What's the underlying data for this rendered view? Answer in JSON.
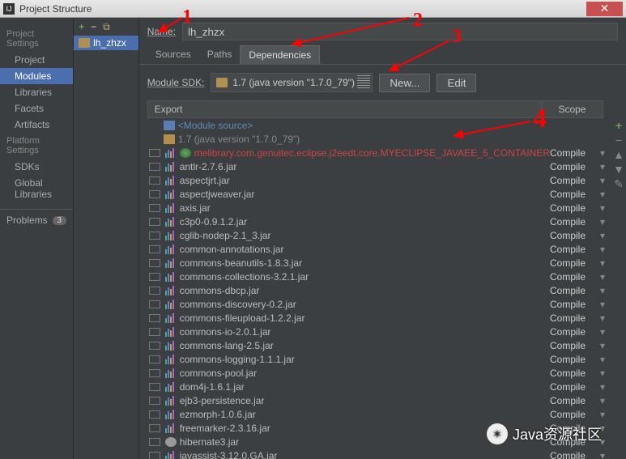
{
  "titlebar": {
    "title": "Project Structure"
  },
  "sidebar": {
    "project_settings_label": "Project Settings",
    "platform_settings_label": "Platform Settings",
    "items": {
      "project": "Project",
      "modules": "Modules",
      "libraries": "Libraries",
      "facets": "Facets",
      "artifacts": "Artifacts",
      "sdks": "SDKs",
      "global_libraries": "Global Libraries"
    },
    "problems_label": "Problems",
    "problems_count": "3"
  },
  "modules": {
    "selected": "lh_zhzx"
  },
  "content": {
    "name_label": "Name:",
    "name_value": "lh_zhzx",
    "tabs": {
      "sources": "Sources",
      "paths": "Paths",
      "dependencies": "Dependencies"
    },
    "sdk_label": "Module SDK:",
    "sdk_value": "1.7 (java version \"1.7.0_79\")",
    "btn_new": "New...",
    "btn_edit": "Edit",
    "header_export": "Export",
    "header_scope": "Scope",
    "dependencies": [
      {
        "kind": "module-src",
        "name": "<Module source>",
        "color": "blue",
        "hasCheck": false,
        "scope": ""
      },
      {
        "kind": "sdk",
        "name": "1.7 (java version \"1.7.0_79\")",
        "color": "gray",
        "hasCheck": false,
        "scope": ""
      },
      {
        "kind": "bars",
        "name": "melibrary.com.genuitec.eclipse.j2eedt.core.MYECLIPSE_JAVAEE_5_CONTAINER",
        "color": "red",
        "hasCheck": true,
        "scope": "Compile"
      },
      {
        "kind": "bars",
        "name": "antlr-2.7.6.jar",
        "color": "",
        "hasCheck": true,
        "scope": "Compile"
      },
      {
        "kind": "bars",
        "name": "aspectjrt.jar",
        "color": "",
        "hasCheck": true,
        "scope": "Compile"
      },
      {
        "kind": "bars",
        "name": "aspectjweaver.jar",
        "color": "",
        "hasCheck": true,
        "scope": "Compile"
      },
      {
        "kind": "bars",
        "name": "axis.jar",
        "color": "",
        "hasCheck": true,
        "scope": "Compile"
      },
      {
        "kind": "bars",
        "name": "c3p0-0.9.1.2.jar",
        "color": "",
        "hasCheck": true,
        "scope": "Compile"
      },
      {
        "kind": "bars",
        "name": "cglib-nodep-2.1_3.jar",
        "color": "",
        "hasCheck": true,
        "scope": "Compile"
      },
      {
        "kind": "bars",
        "name": "common-annotations.jar",
        "color": "",
        "hasCheck": true,
        "scope": "Compile"
      },
      {
        "kind": "bars",
        "name": "commons-beanutils-1.8.3.jar",
        "color": "",
        "hasCheck": true,
        "scope": "Compile"
      },
      {
        "kind": "bars",
        "name": "commons-collections-3.2.1.jar",
        "color": "",
        "hasCheck": true,
        "scope": "Compile"
      },
      {
        "kind": "bars",
        "name": "commons-dbcp.jar",
        "color": "",
        "hasCheck": true,
        "scope": "Compile"
      },
      {
        "kind": "bars",
        "name": "commons-discovery-0.2.jar",
        "color": "",
        "hasCheck": true,
        "scope": "Compile"
      },
      {
        "kind": "bars",
        "name": "commons-fileupload-1.2.2.jar",
        "color": "",
        "hasCheck": true,
        "scope": "Compile"
      },
      {
        "kind": "bars",
        "name": "commons-io-2.0.1.jar",
        "color": "",
        "hasCheck": true,
        "scope": "Compile"
      },
      {
        "kind": "bars",
        "name": "commons-lang-2.5.jar",
        "color": "",
        "hasCheck": true,
        "scope": "Compile"
      },
      {
        "kind": "bars",
        "name": "commons-logging-1.1.1.jar",
        "color": "",
        "hasCheck": true,
        "scope": "Compile"
      },
      {
        "kind": "bars",
        "name": "commons-pool.jar",
        "color": "",
        "hasCheck": true,
        "scope": "Compile"
      },
      {
        "kind": "bars",
        "name": "dom4j-1.6.1.jar",
        "color": "",
        "hasCheck": true,
        "scope": "Compile"
      },
      {
        "kind": "bars",
        "name": "ejb3-persistence.jar",
        "color": "",
        "hasCheck": true,
        "scope": "Compile"
      },
      {
        "kind": "bars",
        "name": "ezmorph-1.0.6.jar",
        "color": "",
        "hasCheck": true,
        "scope": "Compile"
      },
      {
        "kind": "bars",
        "name": "freemarker-2.3.16.jar",
        "color": "",
        "hasCheck": true,
        "scope": "Compile"
      },
      {
        "kind": "disk",
        "name": "hibernate3.jar",
        "color": "",
        "hasCheck": true,
        "scope": "Compile"
      },
      {
        "kind": "bars",
        "name": "javassist-3.12.0.GA.jar",
        "color": "",
        "hasCheck": true,
        "scope": "Compile"
      }
    ]
  },
  "annotations": {
    "n1": "1",
    "n2": "2",
    "n3": "3",
    "n4": "4"
  },
  "watermark": "Java资源社区"
}
